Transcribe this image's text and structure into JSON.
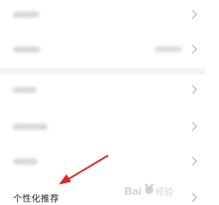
{
  "settings": {
    "rows": [
      {
        "id": "row-1",
        "label_visible": false,
        "value_visible": false
      },
      {
        "id": "row-2",
        "label_visible": false,
        "value_visible": true
      },
      {
        "id": "row-3",
        "label_visible": false,
        "value_visible": false
      },
      {
        "id": "row-4",
        "label_visible": false,
        "value_visible": false
      },
      {
        "id": "row-5",
        "label_visible": false,
        "value_visible": false
      }
    ],
    "personalized_recommendation_label": "个性化推荐"
  },
  "colors": {
    "background": "#ffffff",
    "divider": "#f4f4f4",
    "annotation_arrow": "#e8231c",
    "chevron": "#b9b9b9"
  },
  "icons": {
    "chevron": "chevron-right-icon",
    "watermark": "baidu-jingyan-watermark"
  },
  "watermark_text": "Bai 经验"
}
